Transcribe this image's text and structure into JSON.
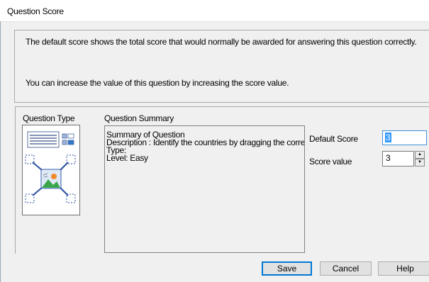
{
  "window": {
    "title": "Question Score"
  },
  "info": {
    "line1": "The default score shows the total score that would normally be awarded for answering this question correctly.",
    "line2": "You can increase the value of this question by increasing the score value."
  },
  "question_type": {
    "label": "Question Type",
    "icon": "drag-and-drop-image-question-icon"
  },
  "summary": {
    "label": "Question Summary",
    "lines": [
      "Summary of Question",
      "Description : Identify the countries by dragging the correct",
      "Type:",
      "Level: Easy"
    ]
  },
  "default_score": {
    "label": "Default Score",
    "value": "3"
  },
  "score_value": {
    "label": "Score value",
    "value": "3"
  },
  "buttons": {
    "save": "Save",
    "cancel": "Cancel",
    "help": "Help"
  },
  "colors": {
    "focus_border": "#0078d7",
    "selection": "#3399ff",
    "dialog_bg": "#f0f0f0"
  }
}
